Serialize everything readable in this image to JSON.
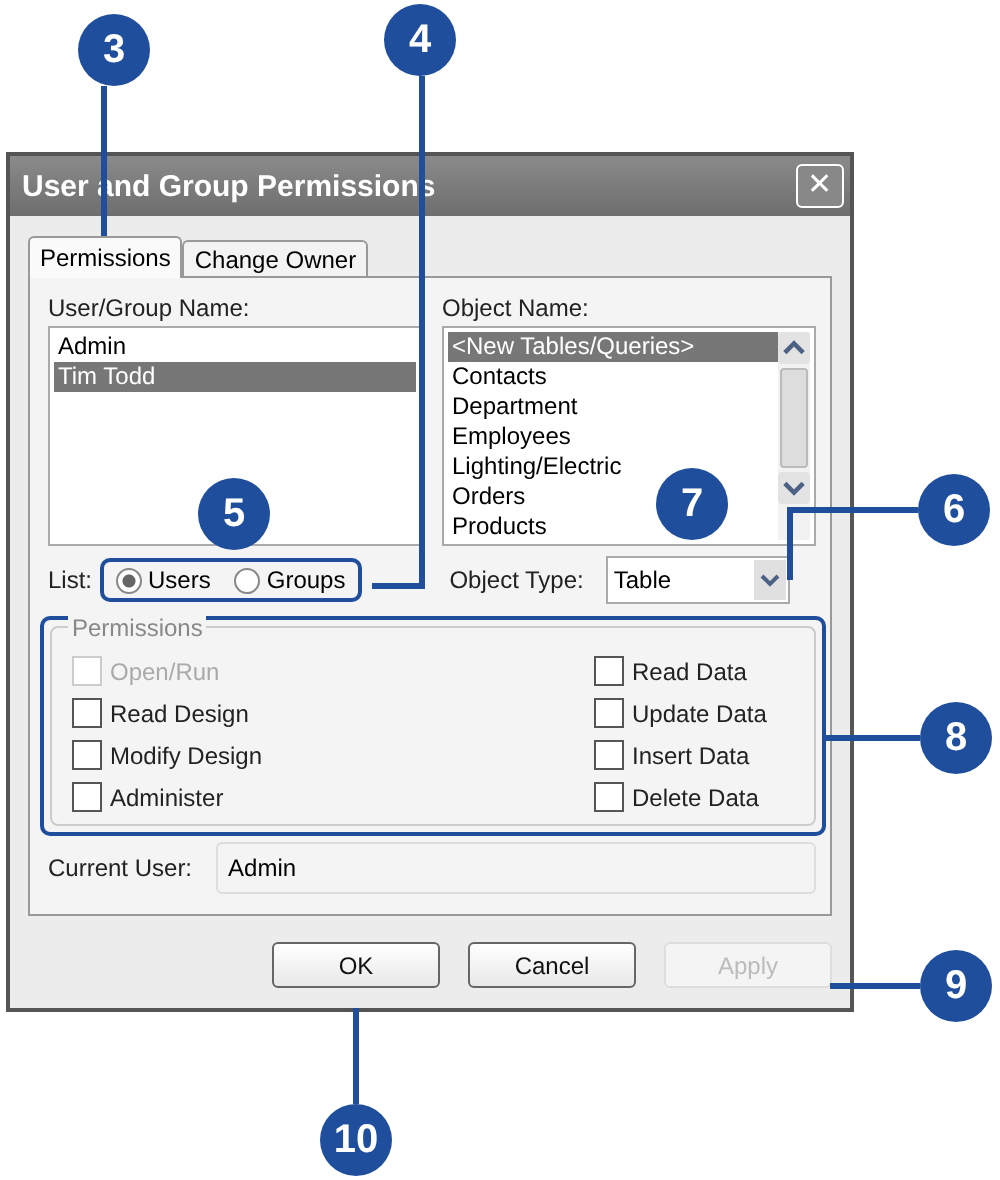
{
  "window": {
    "title": "User and Group Permissions",
    "close": "✕"
  },
  "tabs": [
    {
      "label": "Permissions",
      "selected": true
    },
    {
      "label": "Change Owner",
      "selected": false
    }
  ],
  "user_list": {
    "label": "User/Group Name:",
    "items": [
      {
        "label": "Admin",
        "selected": false
      },
      {
        "label": "Tim Todd",
        "selected": true
      }
    ]
  },
  "object_list": {
    "label": "Object Name:",
    "items": [
      {
        "label": "<New Tables/Queries>",
        "selected": true
      },
      {
        "label": "Contacts",
        "selected": false
      },
      {
        "label": "Department",
        "selected": false
      },
      {
        "label": "Employees",
        "selected": false
      },
      {
        "label": "Lighting/Electric",
        "selected": false
      },
      {
        "label": "Orders",
        "selected": false
      },
      {
        "label": "Products",
        "selected": false
      }
    ]
  },
  "list_filter": {
    "label": "List:",
    "options": [
      {
        "label": "Users",
        "selected": true
      },
      {
        "label": "Groups",
        "selected": false
      }
    ]
  },
  "object_type": {
    "label": "Object Type:",
    "value": "Table"
  },
  "permissions": {
    "title": "Permissions",
    "left": [
      {
        "label": "Open/Run",
        "checked": false,
        "disabled": true
      },
      {
        "label": "Read Design",
        "checked": false,
        "disabled": false
      },
      {
        "label": "Modify Design",
        "checked": false,
        "disabled": false
      },
      {
        "label": "Administer",
        "checked": false,
        "disabled": false
      }
    ],
    "right": [
      {
        "label": "Read Data",
        "checked": false,
        "disabled": false
      },
      {
        "label": "Update Data",
        "checked": false,
        "disabled": false
      },
      {
        "label": "Insert Data",
        "checked": false,
        "disabled": false
      },
      {
        "label": "Delete Data",
        "checked": false,
        "disabled": false
      }
    ]
  },
  "current_user": {
    "label": "Current User:",
    "value": "Admin"
  },
  "buttons": [
    {
      "label": "OK",
      "disabled": false
    },
    {
      "label": "Cancel",
      "disabled": false
    },
    {
      "label": "Apply",
      "disabled": true
    }
  ],
  "callouts": [
    "3",
    "4",
    "5",
    "7",
    "6",
    "8",
    "9",
    "10"
  ]
}
